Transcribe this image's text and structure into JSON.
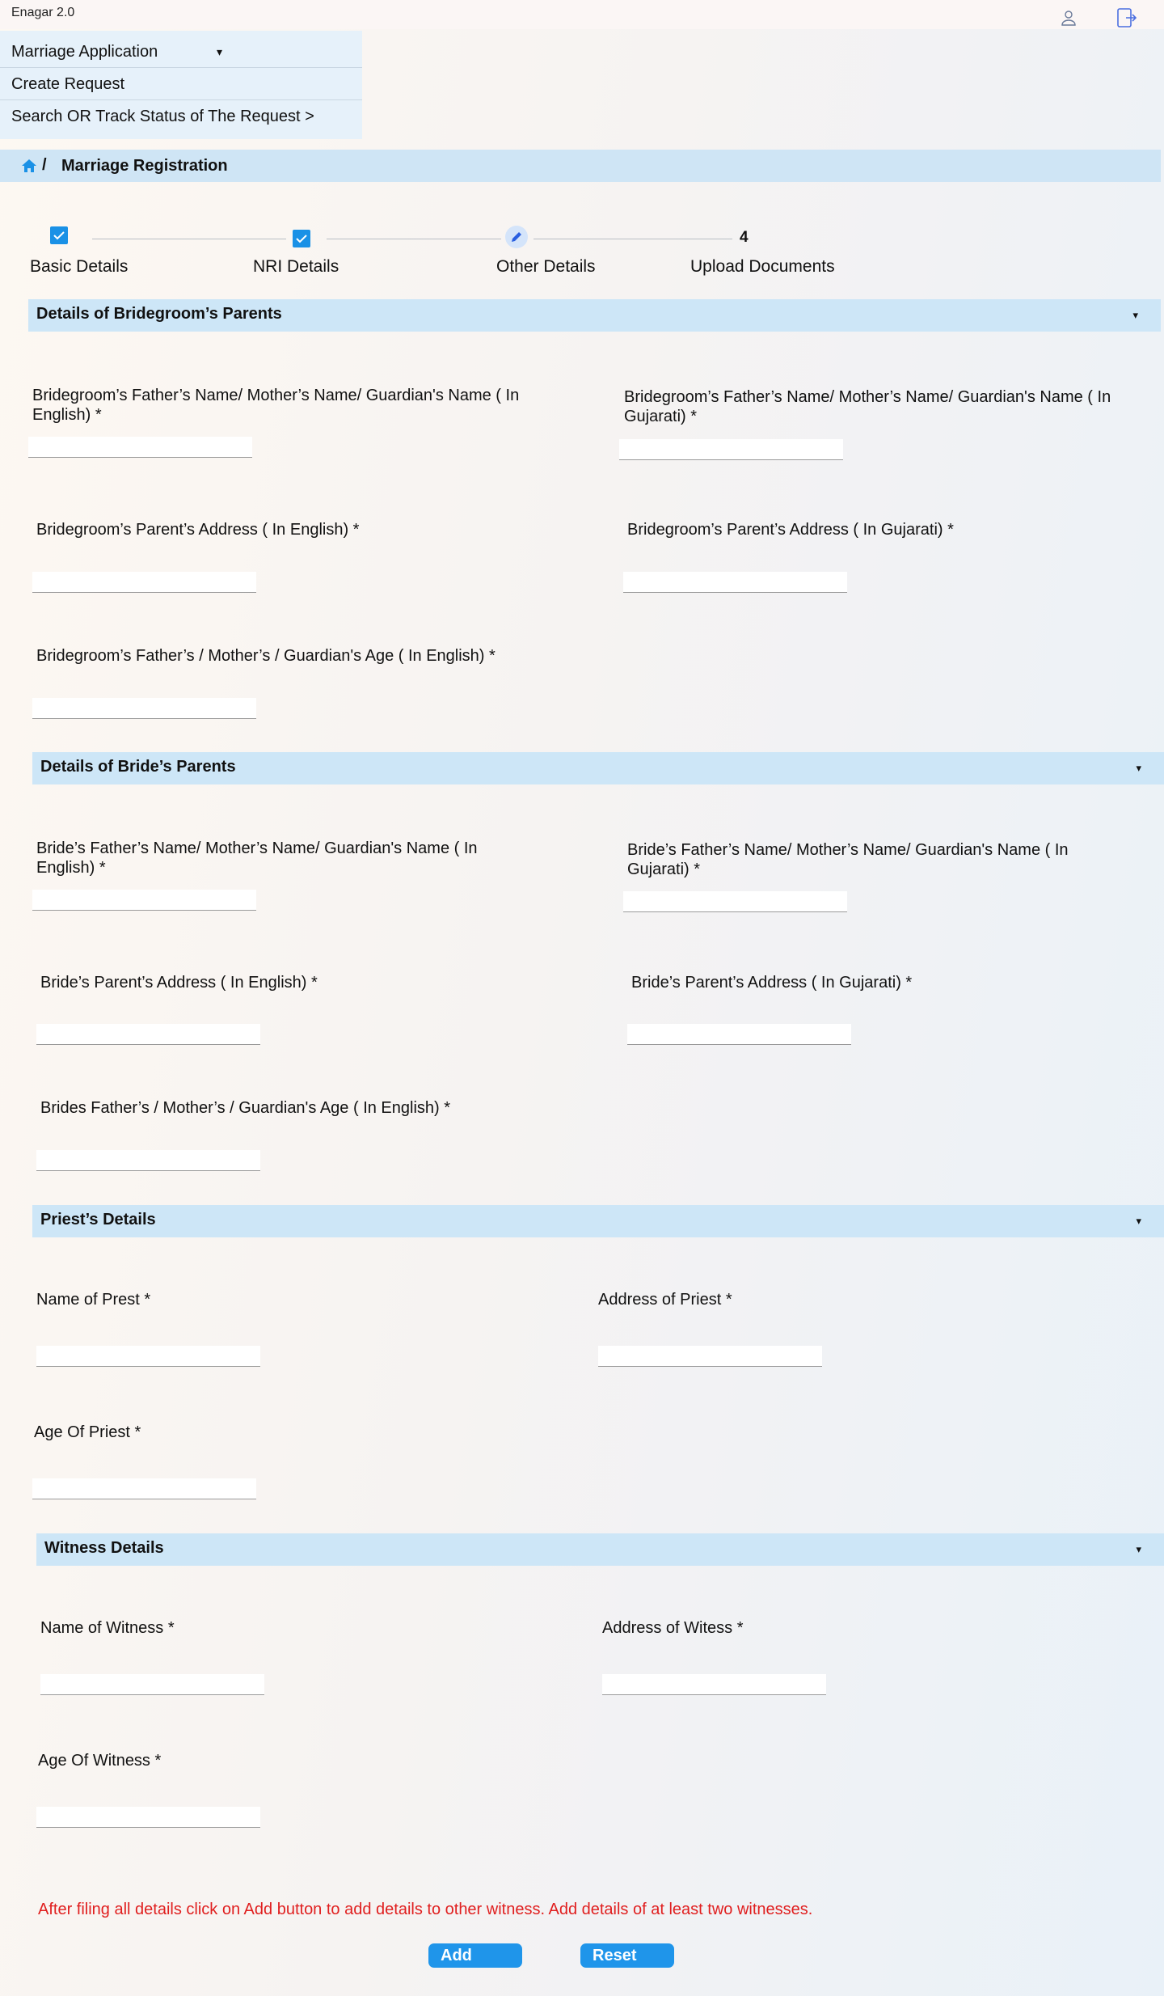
{
  "app": {
    "title": "Enagar 2.0"
  },
  "menu": {
    "items": [
      {
        "label": "Marriage Application",
        "caret": "▾"
      },
      {
        "label": "Create Request"
      },
      {
        "label": "Search OR Track Status of The Request  >"
      }
    ]
  },
  "breadcrumb": {
    "separator": "/",
    "current": "Marriage Registration"
  },
  "stepper": {
    "steps": [
      {
        "label": "Basic Details",
        "state": "done"
      },
      {
        "label": "NRI Details",
        "state": "done"
      },
      {
        "label": "Other Details",
        "state": "current"
      },
      {
        "label": "Upload Documents",
        "number": "4",
        "state": "pending"
      }
    ]
  },
  "sections": {
    "groom_parents": {
      "title": "Details of Bridegroom’s Parents",
      "caret": "▾",
      "name_en_label": "Bridegroom’s Father’s Name/ Mother’s Name/ Guardian's  Name ( In English) *",
      "name_gu_label": "Bridegroom’s Father’s Name/ Mother’s Name/ Guardian's  Name ( In Gujarati) *",
      "addr_en_label": "Bridegroom’s Parent’s Address ( In English) *",
      "addr_gu_label": "Bridegroom’s Parent’s Address ( In Gujarati) *",
      "age_label": "Bridegroom’s Father’s / Mother’s / Guardian's  Age ( In English) *"
    },
    "bride_parents": {
      "title": "Details of Bride’s Parents",
      "caret": "▾",
      "name_en_label": "Bride’s Father’s Name/ Mother’s Name/ Guardian's  Name ( In English) *",
      "name_gu_label": "Bride’s Father’s Name/ Mother’s Name/ Guardian's  Name ( In Gujarati) *",
      "addr_en_label": "Bride’s Parent’s Address ( In English) *",
      "addr_gu_label": "Bride’s Parent’s Address ( In Gujarati) *",
      "age_label": "Brides Father’s / Mother’s / Guardian's  Age ( In English) *"
    },
    "priest": {
      "title": "Priest’s Details",
      "caret": "▾",
      "name_label": "Name of Prest *",
      "address_label": "Address of Priest *",
      "age_label": "Age Of Priest *"
    },
    "witness": {
      "title": "Witness Details",
      "caret": "▾",
      "name_label": "Name of Witness *",
      "address_label": "Address of Witess *",
      "age_label": "Age Of Witness *"
    }
  },
  "note": "After filing all details click on Add button to add details to other witness. Add details of at least two witnesses.",
  "buttons": {
    "add": "Add",
    "reset": "Reset"
  },
  "colors": {
    "accent": "#1f95ea",
    "section_bg": "#cde6f7",
    "warning_text": "#e01f1f"
  }
}
